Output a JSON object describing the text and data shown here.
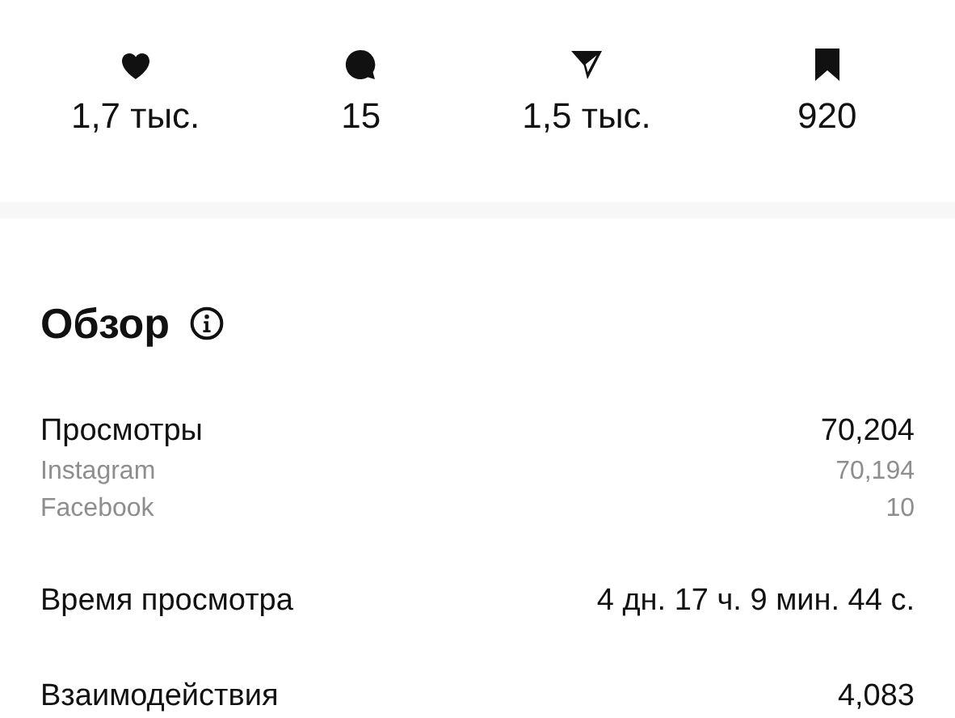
{
  "stats": [
    {
      "kind": "heart",
      "value": "1,7 тыс."
    },
    {
      "kind": "comment",
      "value": "15"
    },
    {
      "kind": "send",
      "value": "1,5 тыс."
    },
    {
      "kind": "bookmark",
      "value": "920"
    }
  ],
  "overview": {
    "title": "Обзор",
    "rows": [
      {
        "kind": "main",
        "label": "Просмотры",
        "value": "70,204"
      },
      {
        "kind": "sub",
        "label": "Instagram",
        "value": "70,194"
      },
      {
        "kind": "sub",
        "label": "Facebook",
        "value": "10"
      },
      {
        "kind": "main",
        "label": "Время просмотра",
        "value": "4 дн. 17 ч. 9 мин. 44 с."
      },
      {
        "kind": "main",
        "label": "Взаимодействия",
        "value": "4,083"
      }
    ]
  }
}
